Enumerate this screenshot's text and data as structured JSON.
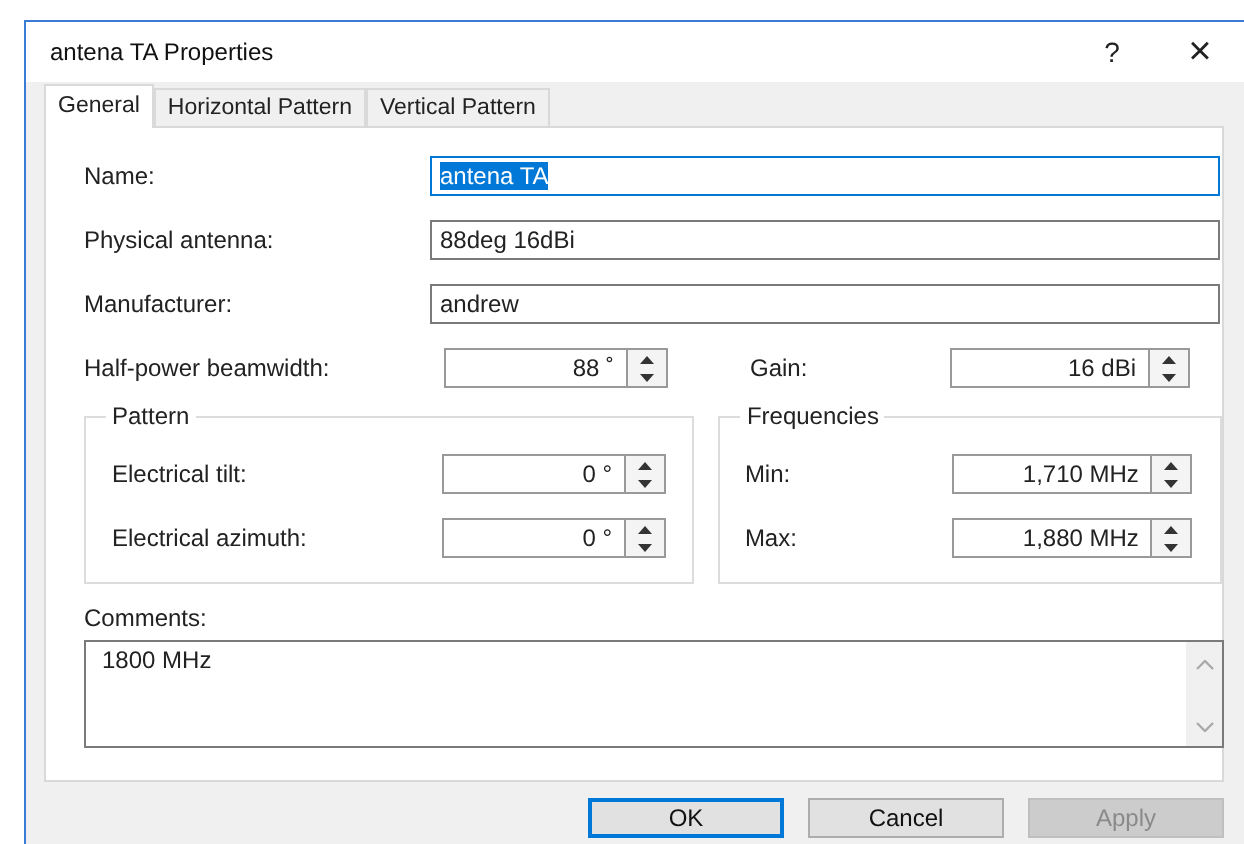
{
  "window": {
    "title": "antena TA Properties",
    "help": "?",
    "close": "×"
  },
  "tabs": [
    {
      "label": "General",
      "selected": true
    },
    {
      "label": "Horizontal Pattern",
      "selected": false
    },
    {
      "label": "Vertical Pattern",
      "selected": false
    }
  ],
  "fields": [
    {
      "label": "Name:",
      "value": "antena TA",
      "focused": true
    },
    {
      "label": "Physical antenna:",
      "value": "88deg 16dBi",
      "focused": false
    },
    {
      "label": "Manufacturer:",
      "value": "andrew",
      "focused": false
    }
  ],
  "beamwidth": {
    "label": "Half-power beamwidth:",
    "value": "88 ˚"
  },
  "gain": {
    "label": "Gain:",
    "value": "16 dBi"
  },
  "pattern": {
    "title": "Pattern",
    "rows": [
      {
        "label": "Electrical tilt:",
        "value": "0 °"
      },
      {
        "label": "Electrical azimuth:",
        "value": "0 °"
      }
    ]
  },
  "frequencies": {
    "title": "Frequencies",
    "rows": [
      {
        "label": "Min:",
        "value": "1,710 MHz"
      },
      {
        "label": "Max:",
        "value": "1,880 MHz"
      }
    ]
  },
  "comments": {
    "label": "Comments:",
    "value": "1800 MHz"
  },
  "buttons": [
    {
      "label": "OK",
      "default": true,
      "disabled": false
    },
    {
      "label": "Cancel",
      "default": false,
      "disabled": false
    },
    {
      "label": "Apply",
      "default": false,
      "disabled": true
    }
  ]
}
